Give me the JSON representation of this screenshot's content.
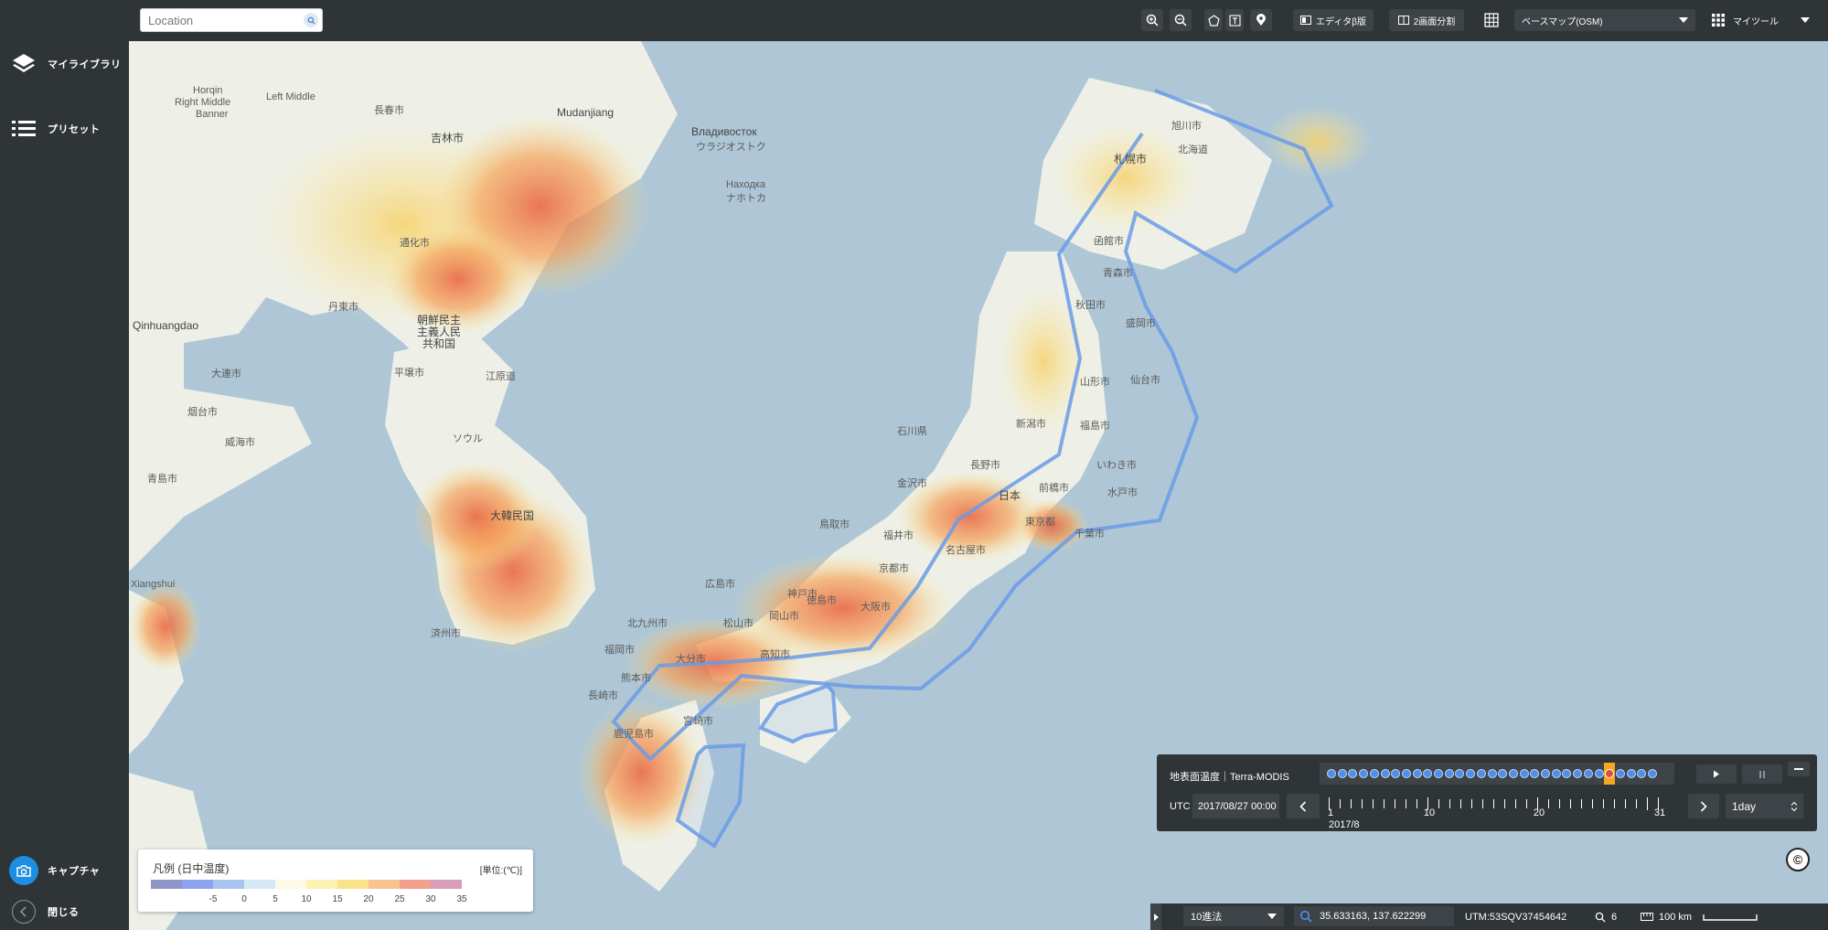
{
  "sidebar": {
    "items": [
      {
        "label": "マイライブラリ",
        "icon": "layers-icon"
      },
      {
        "label": "プリセット",
        "icon": "list-icon"
      }
    ],
    "capture_label": "キャプチャ",
    "close_label": "閉じる"
  },
  "topbar": {
    "search": {
      "placeholder": "Location",
      "value": ""
    },
    "editor_label": "エディタβ版",
    "split_label": "2画面分割",
    "basemap_label": "ベースマップ(OSM)",
    "mytools_label": "マイツール"
  },
  "map": {
    "labels": [
      "Mudanjiang",
      "Владивосток",
      "ウラジオストク",
      "Наxодка",
      "ナホトカ",
      "吉林市",
      "長春市",
      "通化市",
      "丹東市",
      "Qinhuangdao",
      "大連市",
      "朝鮮民主",
      "主義人民",
      "共和国",
      "平壌市",
      "ソウル",
      "大韓民国",
      "江原道",
      "済州市",
      "Xiangshui",
      "烟台市",
      "威海市",
      "青島市",
      "Horqin",
      "Right Middle",
      "Banner",
      "Left Middle",
      "札幌市",
      "旭川市",
      "北海道",
      "函館市",
      "青森市",
      "秋田市",
      "盛岡市",
      "仙台市",
      "山形市",
      "福島市",
      "新潟市",
      "いわき市",
      "長野市",
      "金沢市",
      "福井市",
      "日本",
      "前橋市",
      "水戸市",
      "東京都",
      "千葉市",
      "名古屋市",
      "京都市",
      "大阪市",
      "神戸市",
      "広島市",
      "岡山市",
      "松山市",
      "高知市",
      "徳島市",
      "北九州市",
      "福岡市",
      "大分市",
      "熊本市",
      "長崎市",
      "宮崎市",
      "鹿児島市",
      "鳥取市",
      "石川県"
    ]
  },
  "legend": {
    "title": "凡例 (日中温度)",
    "unit": "[単位:(℃)]",
    "ticks": [
      "-5",
      "0",
      "5",
      "10",
      "15",
      "20",
      "25",
      "30",
      "35"
    ],
    "colors": [
      "#8d96c7",
      "#8ba3ef",
      "#a8c5ef",
      "#d5e8f8",
      "#fdfbe6",
      "#fdf2b4",
      "#fbe38a",
      "#f8c38f",
      "#f2a08c",
      "#d7a0b8"
    ]
  },
  "timeline": {
    "layer_name": "地表面温度｜Terra-MODIS",
    "utc_label": "UTC",
    "date_value": "2017/08/27 00:00",
    "scale_ticks": [
      "1",
      "10",
      "20",
      "31"
    ],
    "month_label": "2017/8",
    "selected_day": 27,
    "total_days": 31,
    "step_value": "1day"
  },
  "status": {
    "coord_format": "10進法",
    "coordinates": "35.633163, 137.622299",
    "utm": "UTM:53SQV37454642",
    "zoom": "6",
    "scale": "100 km"
  }
}
